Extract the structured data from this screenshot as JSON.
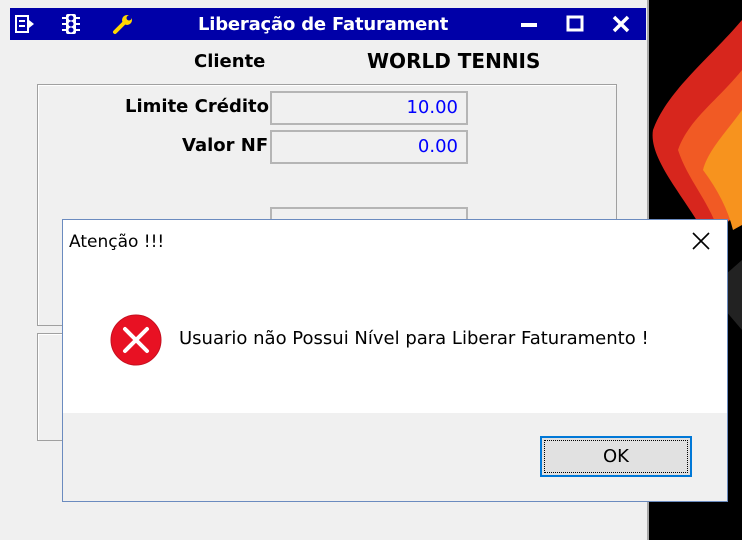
{
  "window": {
    "title": "Liberação de Faturament",
    "icons": [
      "menu-icon",
      "traffic-light-icon",
      "wrench-icon"
    ],
    "controls": [
      "minimize-icon",
      "maximize-icon",
      "close-icon"
    ],
    "title_bar_color": "#0000a8"
  },
  "form": {
    "cliente_label": "Cliente",
    "cliente_value": "WORLD TENNIS",
    "limite_label": "Limite Crédito",
    "limite_value": "10.00",
    "valor_nf_label": "Valor NF",
    "valor_nf_value": "0.00",
    "value_color": "#0000ff"
  },
  "dialog": {
    "title": "Atenção !!!",
    "message": "Usuario não Possui Nível para Liberar Faturamento !",
    "ok_label": "OK",
    "icon": "error-icon",
    "icon_color": "#e81123"
  }
}
